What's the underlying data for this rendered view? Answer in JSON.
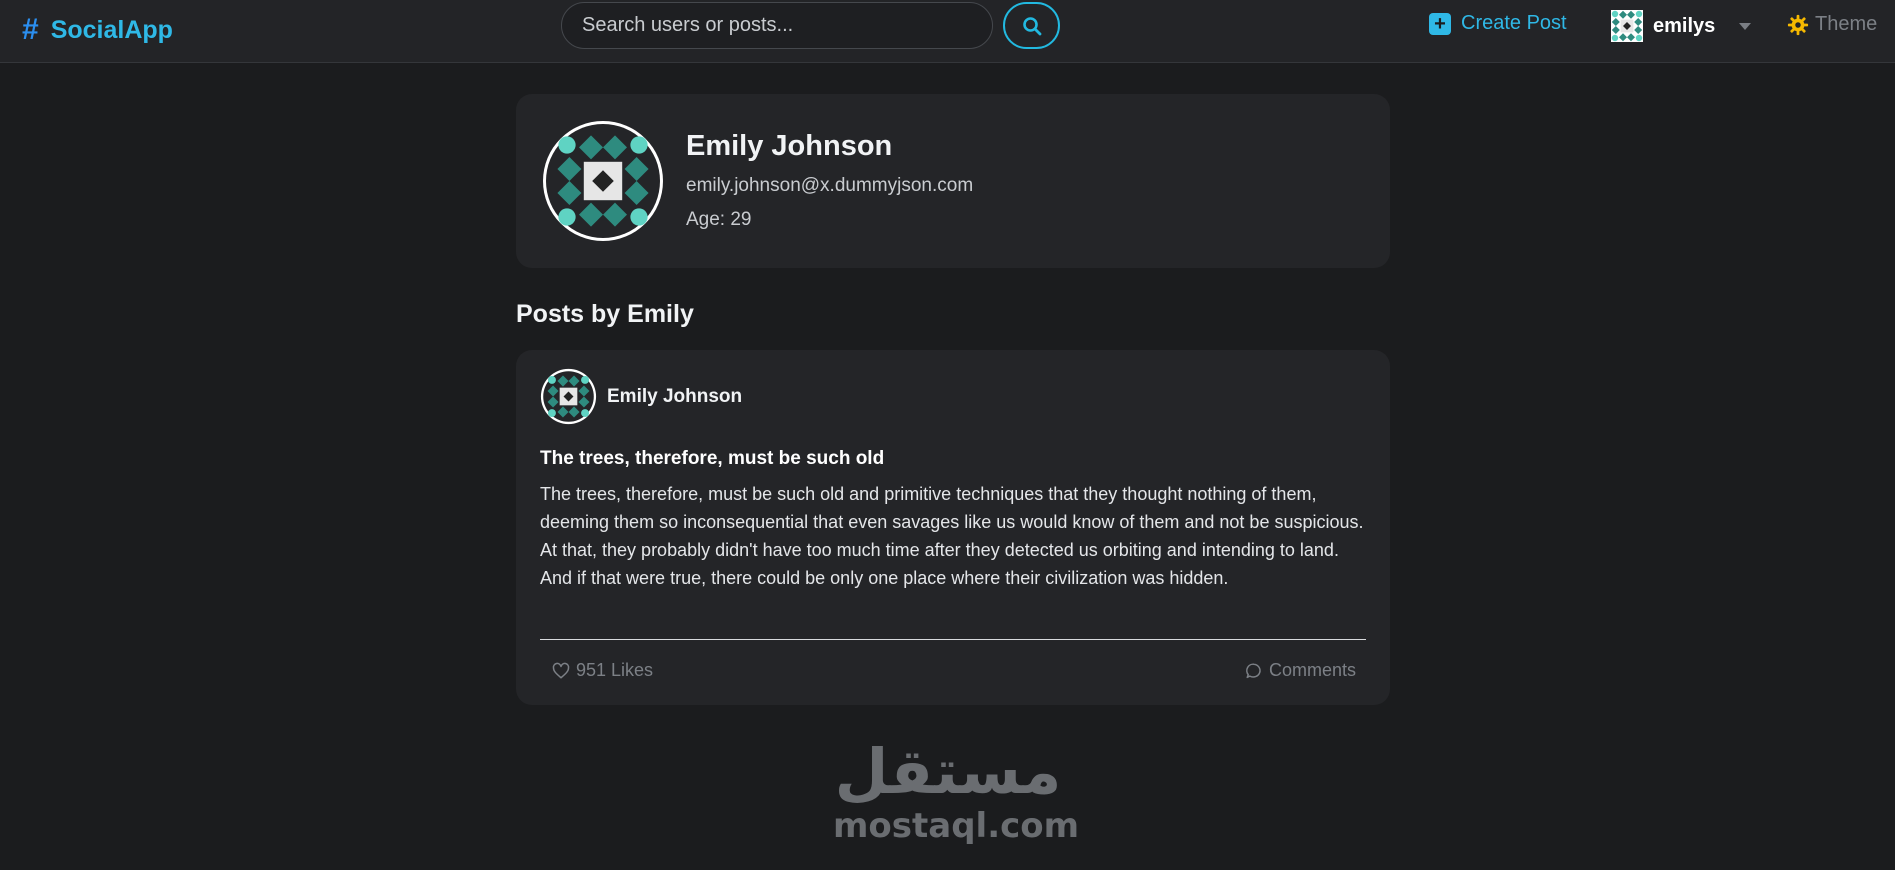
{
  "navbar": {
    "brand_icon": "#",
    "brand_name": "SocialApp",
    "search": {
      "placeholder": "Search users or posts...",
      "value": "",
      "button_icon": "search-icon"
    },
    "create_post_label": "Create Post",
    "user": {
      "username": "emilys",
      "avatar_icon": "identicon-avatar"
    },
    "theme_label": "Theme"
  },
  "profile": {
    "name": "Emily Johnson",
    "email": "emily.johnson@x.dummyjson.com",
    "age_text": "Age: 29"
  },
  "posts_section": {
    "title": "Posts by Emily"
  },
  "posts": [
    {
      "author": "Emily Johnson",
      "title": "The trees, therefore, must be such old",
      "body": "The trees, therefore, must be such old and primitive techniques that they thought nothing of them, deeming them so inconsequential that even savages like us would know of them and not be suspicious. At that, they probably didn't have too much time after they detected us orbiting and intending to land. And if that were true, there could be only one place where their civilization was hidden.",
      "likes_text": "951 Likes",
      "comments_text": "Comments"
    }
  ],
  "watermark": {
    "arabic": "مستقل",
    "latin": "mostaql.com"
  },
  "colors": {
    "accent": "#2fb8e6",
    "brand_hash": "#2b8ff0",
    "theme_icon": "#f5b800",
    "identicon_teal": "#2e8b7f",
    "identicon_light": "#5fd3c3"
  }
}
